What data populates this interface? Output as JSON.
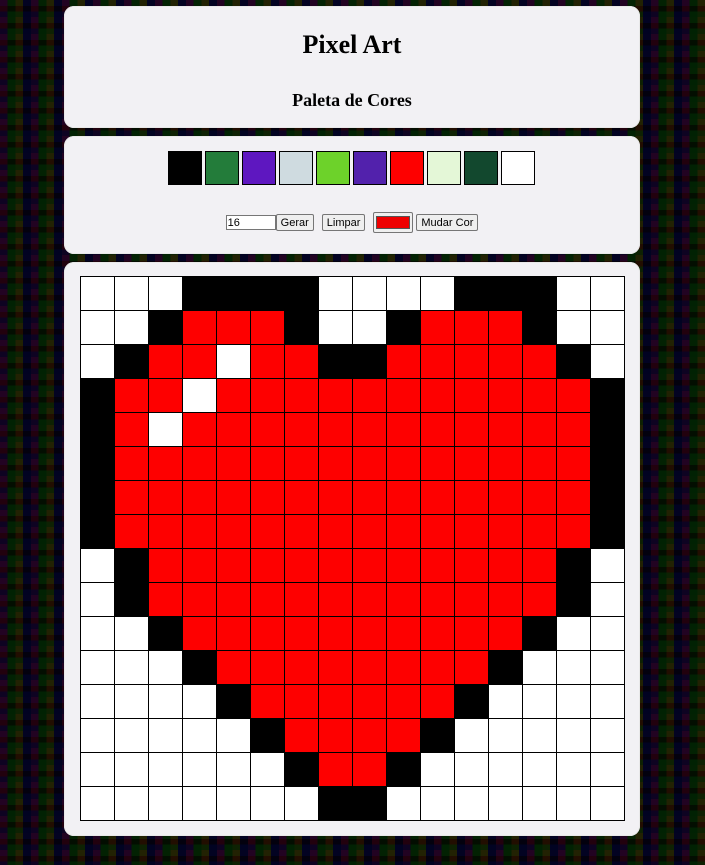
{
  "header": {
    "title": "Pixel Art",
    "subtitle": "Paleta de Cores"
  },
  "palette": [
    "#000000",
    "#237c3a",
    "#5e17c0",
    "#cfdbe0",
    "#6dd22a",
    "#5221ac",
    "#fe0000",
    "#e4f7d7",
    "#12482e",
    "#ffffff"
  ],
  "controls": {
    "size_value": "16",
    "generate_label": "Gerar",
    "clear_label": "Limpar",
    "picker_color": "#ee0000",
    "change_color_label": "Mudar Cor"
  },
  "board": {
    "size": 16,
    "colors": {
      "W": "#ffffff",
      "K": "#000000",
      "R": "#fe0000"
    },
    "rows": [
      "WWWKKKKWWWWKKKWWW",
      "WWKRRRKWWKRRRKWW",
      "WKRRWRRKKRRRRRKW",
      "KRRWRRRRRRRRRRRK",
      "KRWRRRRRRRRRRRRK",
      "KRRRRRRRRRRRRRRK",
      "KRRRRRRRRRRRRRRK",
      "KRRRRRRRRRRRRRRK",
      "WKRRRRRRRRRRRRKW",
      "WKRRRRRRRRRRRRKW",
      "WWKRRRRRRRRRRKWW",
      "WWWKRRRRRRRRKWWW",
      "WWWWKRRRRRRKWWWW",
      "WWWWWKRRRRKWWWWW",
      "WWWWWWKRRKWWWWWW",
      "WWWWWWWKKWWWWWWW"
    ]
  }
}
